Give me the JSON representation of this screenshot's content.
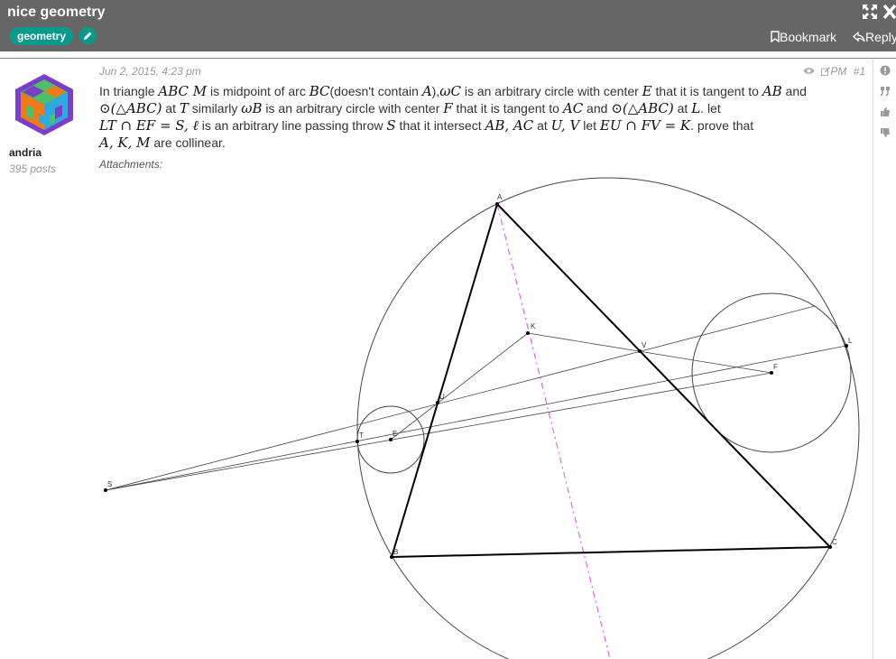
{
  "topic": {
    "title": "nice geometry",
    "tag": "geometry"
  },
  "toolbar": {
    "bookmark_label": "Bookmark",
    "reply_label": "Reply"
  },
  "post": {
    "date": "Jun 2, 2015, 4:23 pm",
    "pm_label": "PM",
    "post_number": "#1",
    "author": "andria",
    "post_count": "395 posts",
    "attachments_label": "Attachments:",
    "body": {
      "t1": "In triangle ",
      "m1": "ABC M",
      "t2": " is midpoint of arc ",
      "m2": "BC",
      "t3": "(doesn't contain ",
      "m3": "A",
      "t4": "),",
      "m4": "ωC",
      "t5": " is an arbitrary circle with center ",
      "m5": "E",
      "t6": " that it is tangent to ",
      "m6": "AB",
      "t7": " and",
      "m7": "⊙(△ABC)",
      "t8": " at ",
      "m8": "T",
      "t9": " similarly ",
      "m9": "ωB",
      "t10": " is an arbitrary circle with center ",
      "m10": "F",
      "t11": " that it is tangent to ",
      "m11": "AC",
      "t12": " and ",
      "m12": "⊙(△ABC)",
      "t13": " at ",
      "m13": "L",
      "t14": ". let",
      "m14": "LT ∩ EF = S, ℓ",
      "t15": " is an arbitrary line passing throw ",
      "m15": "S",
      "t16": " that it intersect ",
      "m16": "AB, AC",
      "t17": " at ",
      "m17": "U, V",
      "t18": " let ",
      "m18": "EU ∩ FV = K",
      "t19": ". prove that",
      "m19": "A, K, M",
      "t20": " are collinear."
    }
  },
  "figure": {
    "point_labels": {
      "A": "A",
      "B": "B",
      "C": "C",
      "K": "K",
      "V": "V",
      "L": "L",
      "F": "F",
      "T": "T",
      "E": "E",
      "S": "S",
      "U": "U"
    },
    "colors": {
      "line": "#444444",
      "triangle": "#000000",
      "axis": "#ee44ee"
    }
  },
  "icons": {
    "expand": "expand-icon",
    "close": "close-icon",
    "bookmark": "bookmark-icon",
    "reply": "reply-icon",
    "eye": "eye-icon",
    "report": "report-icon",
    "quote": "quote-icon",
    "like": "thumbs-up-icon",
    "dislike": "thumbs-down-icon",
    "edit": "pencil-icon"
  }
}
